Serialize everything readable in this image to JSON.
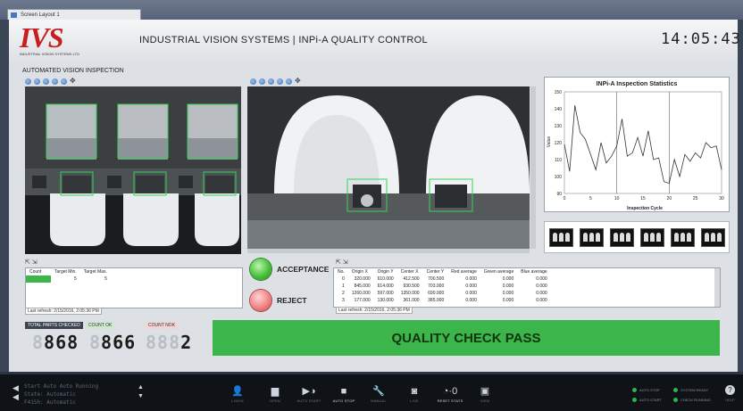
{
  "window": {
    "tab_title": "Screen Layout 1"
  },
  "header": {
    "logo_text": "IVS",
    "logo_sub": "INDUSTRIAL VISION SYSTEMS LTD",
    "title": "INDUSTRIAL VISION SYSTEMS | INPi-A QUALITY CONTROL",
    "clock": "14:05:43"
  },
  "inspection": {
    "section_title": "AUTOMATED VISION INSPECTION"
  },
  "target_table": {
    "columns": [
      "Count",
      "Target Min.",
      "Target Max."
    ],
    "row": [
      "",
      "5",
      "5"
    ],
    "refresh": "Last refresh: 2/15/2016, 2:05:36 PM"
  },
  "buttons": {
    "acceptance": "ACCEPTANCE",
    "reject": "REJECT"
  },
  "results_table": {
    "columns": [
      "No.",
      "Origin X",
      "Origin Y",
      "Center X",
      "Center Y",
      "Red average",
      "Green average",
      "Blue average"
    ],
    "rows": [
      [
        "0",
        "320.000",
        "610.000",
        "412.500",
        "700.500",
        "0.000",
        "0.000",
        "0.000"
      ],
      [
        "1",
        "845.000",
        "614.000",
        "930.500",
        "703.000",
        "0.000",
        "0.000",
        "0.000"
      ],
      [
        "2",
        "1260.000",
        "597.000",
        "1350.000",
        "690.000",
        "0.000",
        "0.000",
        "0.000"
      ],
      [
        "3",
        "177.000",
        "130.000",
        "361.000",
        "385.000",
        "0.000",
        "0.000",
        "0.000"
      ]
    ],
    "refresh": "Last refresh: 2/15/2016, 2:05:36 PM"
  },
  "counters": {
    "total_label": "TOTAL PARTS CHECKED",
    "total_value": "868",
    "ok_label": "COUNT OK",
    "ok_value": "866",
    "nok_label": "COUNT NOK",
    "nok_value": "2"
  },
  "status": {
    "text": "QUALITY CHECK PASS",
    "color": "#3cb54a"
  },
  "taskbar": {
    "log_lines": [
      "Start Auto Auto Running",
      "State: Automatic",
      "F415h: Automatic"
    ],
    "items": [
      {
        "label": "LOGIN",
        "icon": "user-icon"
      },
      {
        "label": "OPEN",
        "icon": "folder-icon"
      },
      {
        "label": "AUTO START",
        "icon": "play-icon"
      },
      {
        "label": "AUTO STOP",
        "icon": "stop-icon"
      },
      {
        "label": "MANUAL",
        "icon": "wrench-icon"
      },
      {
        "label": "LIVE",
        "icon": "camera-icon"
      },
      {
        "label": "RESET STATS",
        "icon": "reset-icon"
      },
      {
        "label": "VIEW",
        "icon": "monitor-icon"
      }
    ],
    "status": [
      {
        "label": "AUTO STOP"
      },
      {
        "label": "SYSTEM READY"
      },
      {
        "label": "AUTO START"
      },
      {
        "label": "CHECK RUNNING"
      }
    ],
    "help_label": "HELP"
  },
  "chart_data": {
    "type": "line",
    "title": "INPi-A Inspection Statistics",
    "xlabel": "Inspection Cycle",
    "ylabel": "Value",
    "xlim": [
      0,
      30
    ],
    "ylim": [
      90,
      150
    ],
    "xticks": [
      0,
      5,
      10,
      15,
      20,
      25,
      30
    ],
    "yticks": [
      90,
      100,
      110,
      120,
      130,
      140,
      150
    ],
    "vlines": [
      10,
      20
    ],
    "x": [
      0,
      1,
      2,
      3,
      4,
      5,
      6,
      7,
      8,
      9,
      10,
      11,
      12,
      13,
      14,
      15,
      16,
      17,
      18,
      19,
      20,
      21,
      22,
      23,
      24,
      25,
      26,
      27,
      28,
      29,
      30
    ],
    "series": [
      {
        "values": [
          119,
          103,
          142,
          126,
          122,
          113,
          104,
          120,
          108,
          112,
          118,
          134,
          112,
          114,
          123,
          112,
          127,
          110,
          111,
          97,
          96,
          110,
          100,
          113,
          109,
          114,
          111,
          120,
          117,
          118,
          104
        ]
      }
    ]
  }
}
